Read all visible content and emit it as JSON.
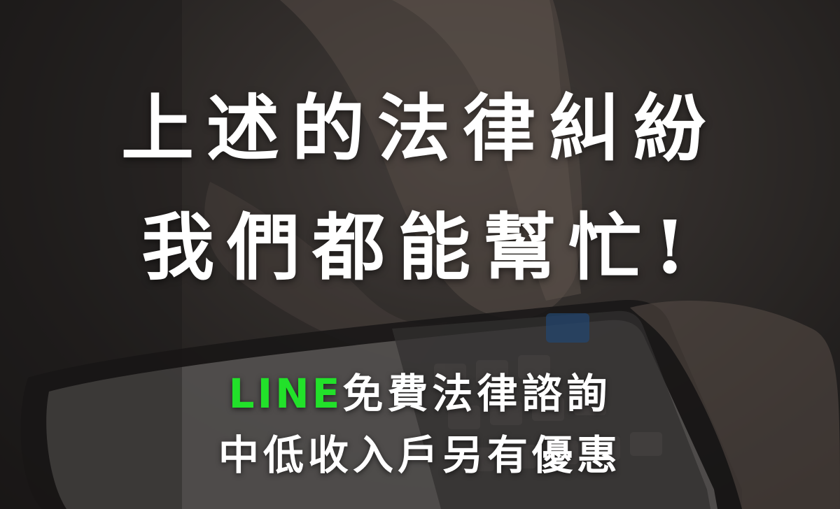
{
  "headline": {
    "line1": "上述的法律糾紛",
    "line2": "我們都能幫忙!"
  },
  "subtext": {
    "brand": "LINE",
    "line1_rest": "免費法律諮詢",
    "line2": "中低收入戶另有優惠"
  },
  "colors": {
    "brand_green": "#22e12a",
    "text": "#ffffff"
  }
}
